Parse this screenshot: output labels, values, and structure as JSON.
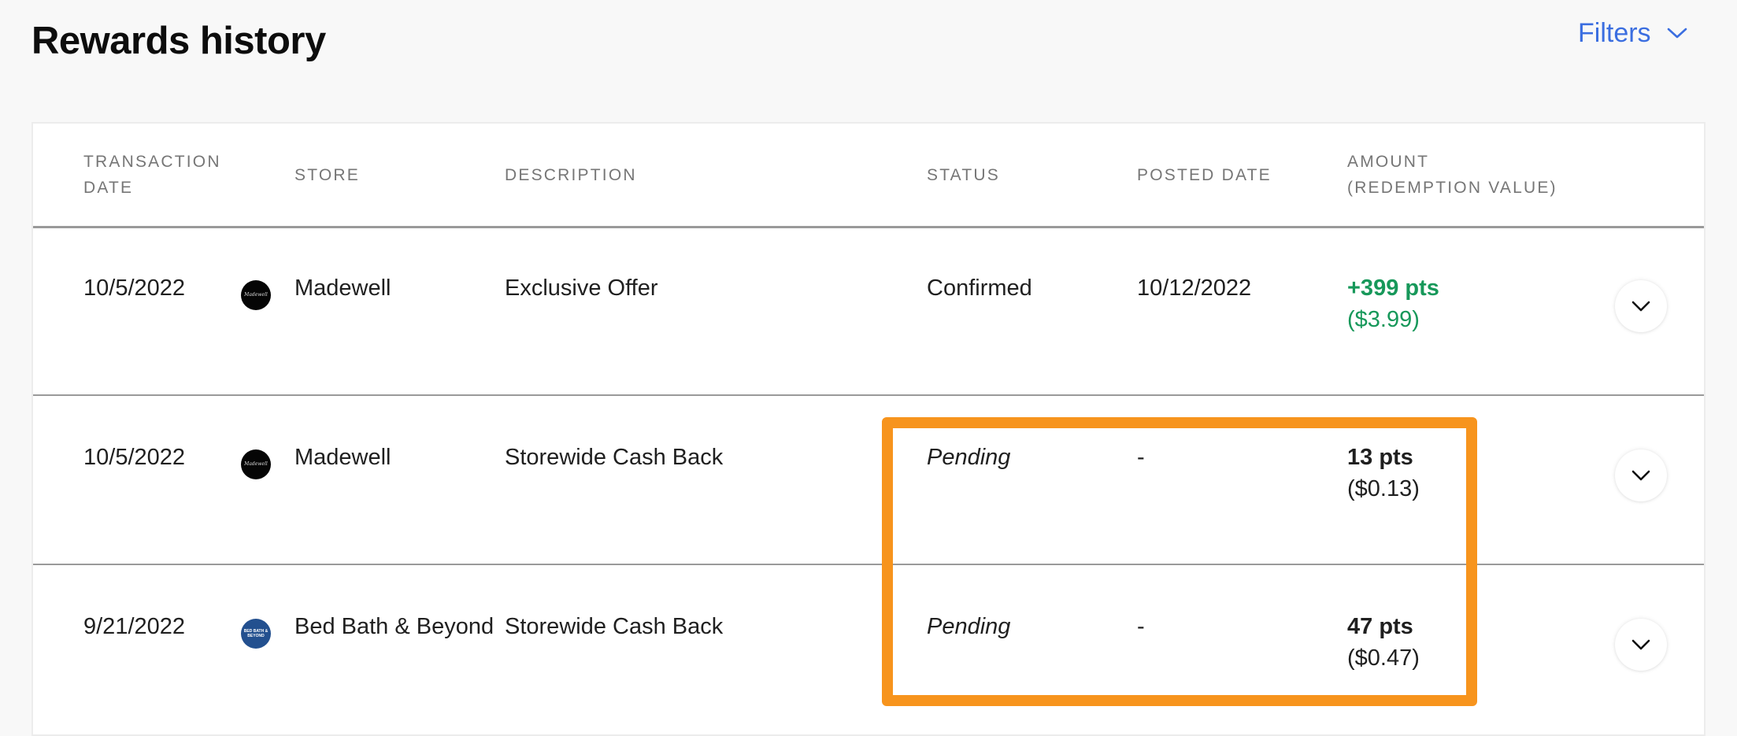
{
  "page": {
    "title": "Rewards history",
    "filters_label": "Filters"
  },
  "table": {
    "headers": {
      "transaction_date": "Transaction\nDate",
      "store": "Store",
      "description": "Description",
      "status": "Status",
      "posted_date": "Posted Date",
      "amount": "Amount\n(Redemption Value)"
    },
    "rows": [
      {
        "transaction_date": "10/5/2022",
        "store_logo": "madewell-logo",
        "store_logo_text": "Madewell",
        "store": "Madewell",
        "description": "Exclusive Offer",
        "status": "Confirmed",
        "posted_date": "10/12/2022",
        "amount_pts": "+399 pts",
        "amount_value": "($3.99)",
        "amount_color": "#17985a"
      },
      {
        "transaction_date": "10/5/2022",
        "store_logo": "madewell-logo",
        "store_logo_text": "Madewell",
        "store": "Madewell",
        "description": "Storewide Cash Back",
        "status": "Pending",
        "posted_date": "-",
        "amount_pts": "13 pts",
        "amount_value": "($0.13)",
        "amount_color": "#1f1f1f"
      },
      {
        "transaction_date": "9/21/2022",
        "store_logo": "bed-bath-beyond-logo",
        "store_logo_text": "BED BATH & BEYOND",
        "store": "Bed Bath & Beyond",
        "description": "Storewide Cash Back",
        "status": "Pending",
        "posted_date": "-",
        "amount_pts": "47 pts",
        "amount_value": "($0.47)",
        "amount_color": "#1f1f1f"
      }
    ]
  },
  "colors": {
    "accent": "#3b6ee0",
    "positive": "#17985a",
    "highlight": "#f7941d",
    "madewell_logo_bg": "#050505",
    "bbb_logo_bg": "#23508f"
  },
  "icons": {
    "filters_chevron": "chevron-down-icon",
    "row_expand": "chevron-down-icon"
  }
}
